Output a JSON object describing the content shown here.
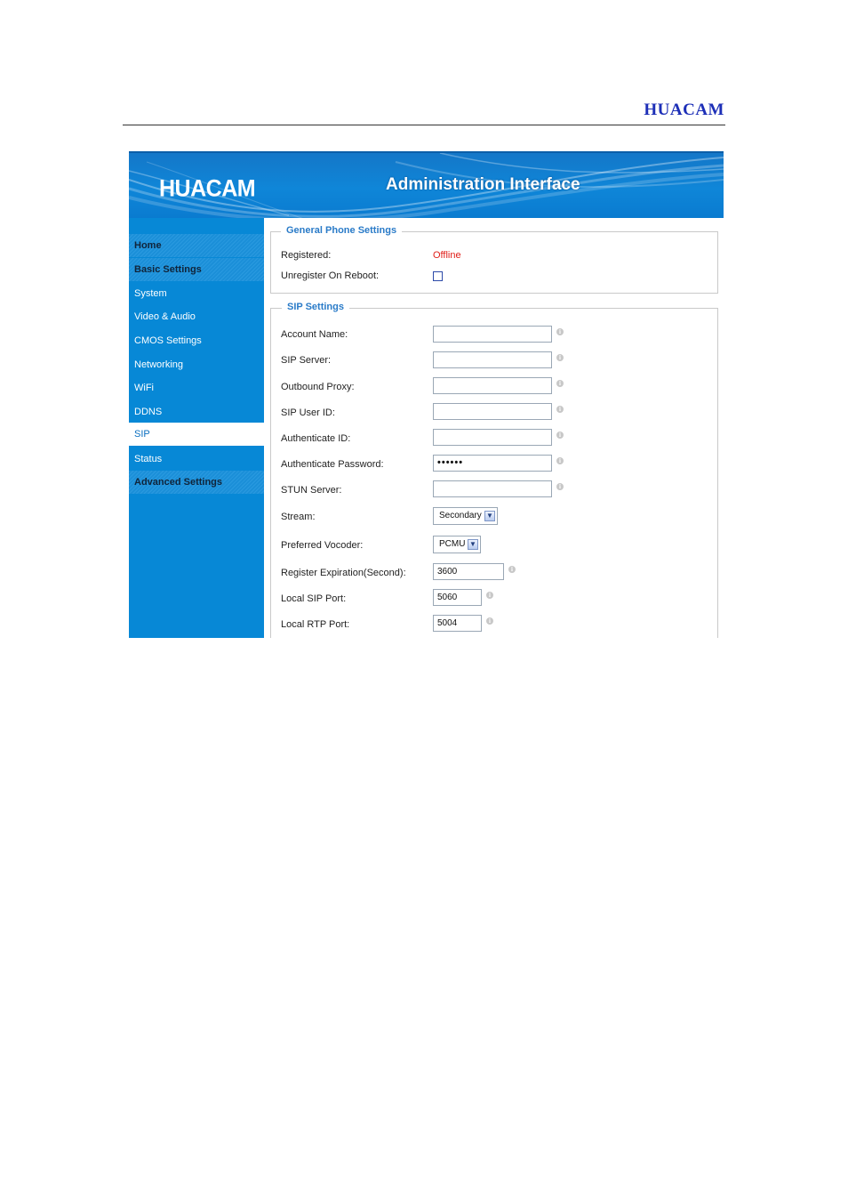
{
  "doc_header": {
    "brand": "HUACAM"
  },
  "banner": {
    "logo": "HUACAM",
    "title": "Administration Interface"
  },
  "sidebar": {
    "items": [
      {
        "label": "Home",
        "type": "group"
      },
      {
        "label": "Basic Settings",
        "type": "group"
      },
      {
        "label": "System",
        "type": "item"
      },
      {
        "label": "Video & Audio",
        "type": "item"
      },
      {
        "label": "CMOS Settings",
        "type": "item"
      },
      {
        "label": "Networking",
        "type": "item"
      },
      {
        "label": "WiFi",
        "type": "item"
      },
      {
        "label": "DDNS",
        "type": "item"
      },
      {
        "label": "SIP",
        "type": "active"
      },
      {
        "label": "Status",
        "type": "item"
      },
      {
        "label": "Advanced Settings",
        "type": "group"
      }
    ]
  },
  "general": {
    "legend": "General Phone Settings",
    "registered_label": "Registered:",
    "registered_value": "Offline",
    "unregister_label": "Unregister On Reboot:",
    "unregister_checked": false
  },
  "sip": {
    "legend": "SIP Settings",
    "account_name": {
      "label": "Account Name:",
      "value": ""
    },
    "sip_server": {
      "label": "SIP Server:",
      "value": ""
    },
    "outbound_proxy": {
      "label": "Outbound Proxy:",
      "value": ""
    },
    "sip_user_id": {
      "label": "SIP User ID:",
      "value": ""
    },
    "authenticate_id": {
      "label": "Authenticate ID:",
      "value": ""
    },
    "authenticate_password": {
      "label": "Authenticate Password:",
      "value": "••••••"
    },
    "stun_server": {
      "label": "STUN Server:",
      "value": ""
    },
    "stream": {
      "label": "Stream:",
      "value": "Secondary"
    },
    "preferred_vocoder": {
      "label": "Preferred Vocoder:",
      "value": "PCMU"
    },
    "register_expiration": {
      "label": "Register Expiration(Second):",
      "value": "3600"
    },
    "local_sip_port": {
      "label": "Local SIP Port:",
      "value": "5060"
    },
    "local_rtp_port": {
      "label": "Local RTP Port:",
      "value": "5004"
    }
  },
  "colors": {
    "brand_blue": "#1d2fb7",
    "sidebar_blue": "#0788d6",
    "legend_blue": "#2a7bc8",
    "offline_red": "#e0201a"
  }
}
